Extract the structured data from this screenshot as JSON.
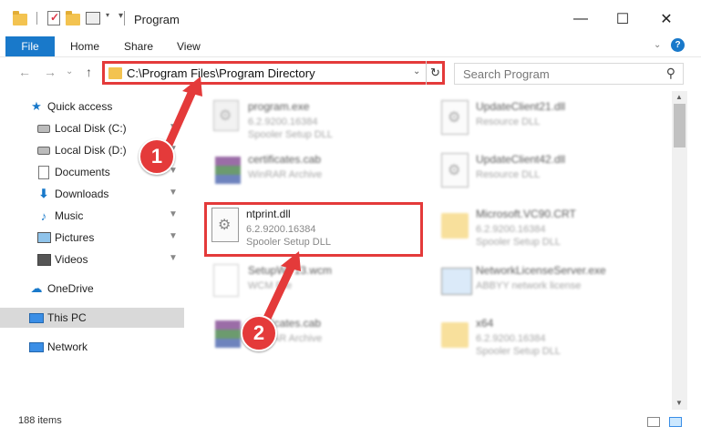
{
  "window": {
    "title": "Program",
    "minimize_glyph": "—",
    "maximize_glyph": "☐",
    "close_glyph": "✕"
  },
  "ribbon": {
    "file_tab": "File",
    "tabs": [
      "Home",
      "Share",
      "View"
    ],
    "help_glyph": "?"
  },
  "navigation": {
    "back_glyph": "←",
    "forward_glyph": "→",
    "recent_glyph": "⌄",
    "up_glyph": "↑",
    "address": "C:\\Program Files\\Program Directory",
    "dropdown_glyph": "⌄",
    "refresh_glyph": "↻",
    "search_placeholder": "Search Program",
    "search_glyph": "⚲"
  },
  "sidebar": {
    "items": [
      {
        "label": "Quick access",
        "icon": "star-icon"
      },
      {
        "label": "Local Disk (C:)",
        "icon": "disk-icon",
        "pinned": true
      },
      {
        "label": "Local Disk (D:)",
        "icon": "disk-icon",
        "pinned": true
      },
      {
        "label": "Documents",
        "icon": "document-icon",
        "pinned": true
      },
      {
        "label": "Downloads",
        "icon": "download-icon",
        "pinned": true
      },
      {
        "label": "Music",
        "icon": "music-icon",
        "pinned": true
      },
      {
        "label": "Pictures",
        "icon": "pictures-icon",
        "pinned": true
      },
      {
        "label": "Videos",
        "icon": "videos-icon",
        "pinned": true
      },
      {
        "label": "OneDrive",
        "icon": "cloud-icon"
      },
      {
        "label": "This PC",
        "icon": "computer-icon",
        "selected": true
      },
      {
        "label": "Network",
        "icon": "network-icon"
      }
    ],
    "pin_glyph": "📌"
  },
  "files": [
    {
      "name": "program.exe",
      "line1": "6.2.9200.16384",
      "line2": "Spooler Setup DLL",
      "icon": "exe-icon",
      "blurred": true
    },
    {
      "name": "UpdateClient21.dll",
      "line1": "Resource DLL",
      "line2": "",
      "icon": "dll-icon",
      "blurred": true
    },
    {
      "name": "certificates.cab",
      "line1": "WinRAR Archive",
      "line2": "",
      "icon": "rar-icon",
      "blurred": true
    },
    {
      "name": "UpdateClient42.dll",
      "line1": "Resource DLL",
      "line2": "",
      "icon": "dll-icon",
      "blurred": true
    },
    {
      "name": "ntprint.dll",
      "line1": "6.2.9200.16384",
      "line2": "Spooler Setup DLL",
      "icon": "dll-icon",
      "blurred": false
    },
    {
      "name": "Microsoft.VC90.CRT",
      "line1": "6.2.9200.16384",
      "line2": "Spooler Setup DLL",
      "icon": "folder-icon",
      "blurred": true
    },
    {
      "name": "SetupWP13.wcm",
      "line1": "WCM File",
      "line2": "",
      "icon": "blank-file-icon",
      "blurred": true
    },
    {
      "name": "NetworkLicenseServer.exe",
      "line1": "ABBYY network license",
      "line2": "",
      "icon": "app-icon",
      "blurred": true
    },
    {
      "name": "certificates.cab",
      "line1": "WinRAR Archive",
      "line2": "",
      "icon": "rar-icon",
      "blurred": true
    },
    {
      "name": "x64",
      "line1": "6.2.9200.16384",
      "line2": "Spooler Setup DLL",
      "icon": "folder-icon",
      "blurred": true
    }
  ],
  "annotations": {
    "badge1": "1",
    "badge2": "2",
    "color": "#e43a3a"
  },
  "status": {
    "item_count": "188 items"
  },
  "colors": {
    "accent": "#1979ca",
    "highlight_red": "#e43a3a",
    "selected_bg": "#d9d9d9"
  }
}
